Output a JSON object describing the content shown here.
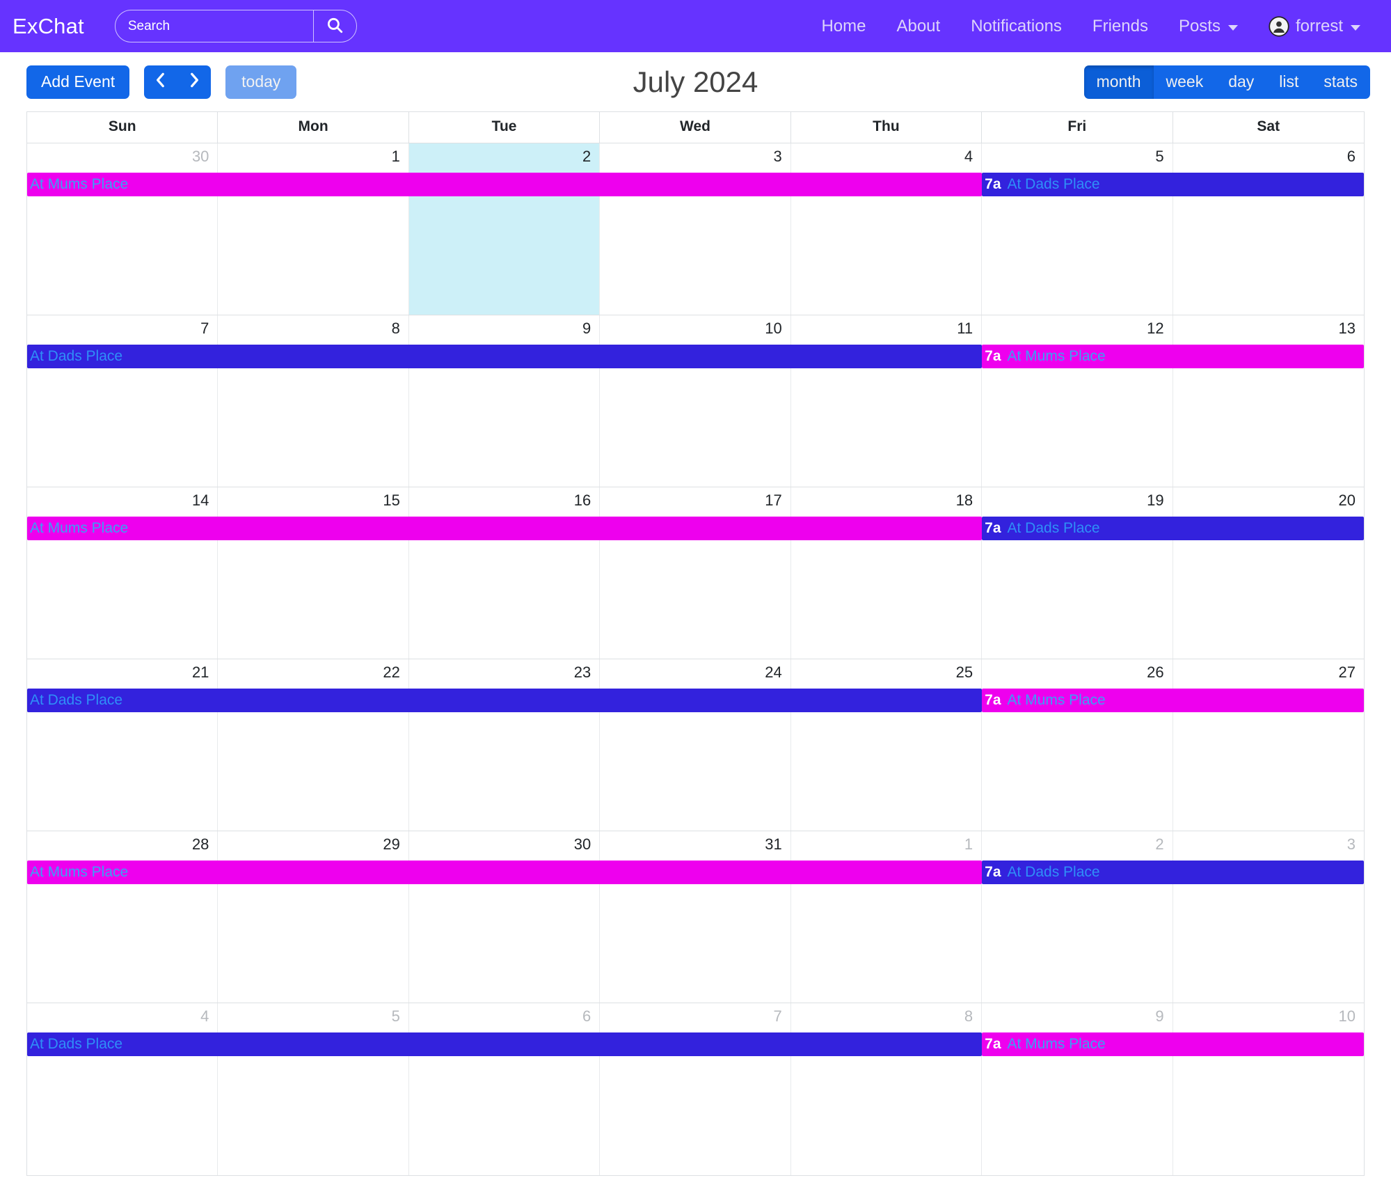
{
  "navbar": {
    "brand": "ExChat",
    "search": {
      "placeholder": "Search",
      "value": "",
      "icon": "search-icon"
    },
    "links": [
      {
        "label": "Home",
        "dropdown": false
      },
      {
        "label": "About",
        "dropdown": false
      },
      {
        "label": "Notifications",
        "dropdown": false
      },
      {
        "label": "Friends",
        "dropdown": false
      },
      {
        "label": "Posts",
        "dropdown": true
      }
    ],
    "user": {
      "label": "forrest",
      "icon": "user-avatar-icon",
      "dropdown": true
    }
  },
  "toolbar": {
    "add_event_label": "Add Event",
    "prev_icon": "chevron-left-icon",
    "next_icon": "chevron-right-icon",
    "today_label": "today",
    "title": "July 2024",
    "views": [
      {
        "label": "month",
        "active": true
      },
      {
        "label": "week",
        "active": false
      },
      {
        "label": "day",
        "active": false
      },
      {
        "label": "list",
        "active": false
      },
      {
        "label": "stats",
        "active": false
      }
    ]
  },
  "calendar": {
    "day_headers": [
      "Sun",
      "Mon",
      "Tue",
      "Wed",
      "Thu",
      "Fri",
      "Sat"
    ],
    "weeks": [
      {
        "days": [
          {
            "num": "30",
            "other": true,
            "today": false
          },
          {
            "num": "1",
            "other": false,
            "today": false
          },
          {
            "num": "2",
            "other": false,
            "today": true
          },
          {
            "num": "3",
            "other": false,
            "today": false
          },
          {
            "num": "4",
            "other": false,
            "today": false
          },
          {
            "num": "5",
            "other": false,
            "today": false
          },
          {
            "num": "6",
            "other": false,
            "today": false
          }
        ],
        "events": [
          {
            "title": "At Mums Place",
            "time": "",
            "kind": "mums",
            "start": 0,
            "span": 5
          },
          {
            "title": "At Dads Place",
            "time": "7a",
            "kind": "dads",
            "start": 5,
            "span": 2
          }
        ]
      },
      {
        "days": [
          {
            "num": "7",
            "other": false,
            "today": false
          },
          {
            "num": "8",
            "other": false,
            "today": false
          },
          {
            "num": "9",
            "other": false,
            "today": false
          },
          {
            "num": "10",
            "other": false,
            "today": false
          },
          {
            "num": "11",
            "other": false,
            "today": false
          },
          {
            "num": "12",
            "other": false,
            "today": false
          },
          {
            "num": "13",
            "other": false,
            "today": false
          }
        ],
        "events": [
          {
            "title": "At Dads Place",
            "time": "",
            "kind": "dads",
            "start": 0,
            "span": 5
          },
          {
            "title": "At Mums Place",
            "time": "7a",
            "kind": "mums",
            "start": 5,
            "span": 2
          }
        ]
      },
      {
        "days": [
          {
            "num": "14",
            "other": false,
            "today": false
          },
          {
            "num": "15",
            "other": false,
            "today": false
          },
          {
            "num": "16",
            "other": false,
            "today": false
          },
          {
            "num": "17",
            "other": false,
            "today": false
          },
          {
            "num": "18",
            "other": false,
            "today": false
          },
          {
            "num": "19",
            "other": false,
            "today": false
          },
          {
            "num": "20",
            "other": false,
            "today": false
          }
        ],
        "events": [
          {
            "title": "At Mums Place",
            "time": "",
            "kind": "mums",
            "start": 0,
            "span": 5
          },
          {
            "title": "At Dads Place",
            "time": "7a",
            "kind": "dads",
            "start": 5,
            "span": 2
          }
        ]
      },
      {
        "days": [
          {
            "num": "21",
            "other": false,
            "today": false
          },
          {
            "num": "22",
            "other": false,
            "today": false
          },
          {
            "num": "23",
            "other": false,
            "today": false
          },
          {
            "num": "24",
            "other": false,
            "today": false
          },
          {
            "num": "25",
            "other": false,
            "today": false
          },
          {
            "num": "26",
            "other": false,
            "today": false
          },
          {
            "num": "27",
            "other": false,
            "today": false
          }
        ],
        "events": [
          {
            "title": "At Dads Place",
            "time": "",
            "kind": "dads",
            "start": 0,
            "span": 5
          },
          {
            "title": "At Mums Place",
            "time": "7a",
            "kind": "mums",
            "start": 5,
            "span": 2
          }
        ]
      },
      {
        "days": [
          {
            "num": "28",
            "other": false,
            "today": false
          },
          {
            "num": "29",
            "other": false,
            "today": false
          },
          {
            "num": "30",
            "other": false,
            "today": false
          },
          {
            "num": "31",
            "other": false,
            "today": false
          },
          {
            "num": "1",
            "other": true,
            "today": false
          },
          {
            "num": "2",
            "other": true,
            "today": false
          },
          {
            "num": "3",
            "other": true,
            "today": false
          }
        ],
        "events": [
          {
            "title": "At Mums Place",
            "time": "",
            "kind": "mums",
            "start": 0,
            "span": 5
          },
          {
            "title": "At Dads Place",
            "time": "7a",
            "kind": "dads",
            "start": 5,
            "span": 2
          }
        ]
      },
      {
        "days": [
          {
            "num": "4",
            "other": true,
            "today": false
          },
          {
            "num": "5",
            "other": true,
            "today": false
          },
          {
            "num": "6",
            "other": true,
            "today": false
          },
          {
            "num": "7",
            "other": true,
            "today": false
          },
          {
            "num": "8",
            "other": true,
            "today": false
          },
          {
            "num": "9",
            "other": true,
            "today": false
          },
          {
            "num": "10",
            "other": true,
            "today": false
          }
        ],
        "events": [
          {
            "title": "At Dads Place",
            "time": "",
            "kind": "dads",
            "start": 0,
            "span": 5
          },
          {
            "title": "At Mums Place",
            "time": "7a",
            "kind": "mums",
            "start": 5,
            "span": 2
          }
        ]
      }
    ]
  },
  "colors": {
    "navbar_bg": "#6633ff",
    "primary_btn": "#1267e8",
    "today_btn": "#6fa2f0",
    "active_view": "#0b5ed7",
    "mums_event": "#ee00ee",
    "dads_event": "#3322dd",
    "event_text": "#2f8ff7",
    "today_cell": "#cdf0f8"
  }
}
